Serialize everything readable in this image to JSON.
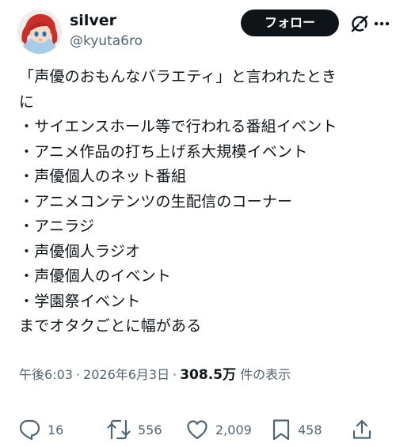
{
  "user": {
    "display_name": "silver",
    "handle": "@kyuta6ro"
  },
  "header": {
    "follow_label": "フォロー"
  },
  "post": {
    "lines": [
      "「声優のおもんなバラエティ」と言われたとき",
      "に",
      "・サイエンスホール等で行われる番組イベント",
      "・アニメ作品の打ち上げ系大規模イベント",
      "・声優個人のネット番組",
      "・アニメコンテンツの生配信のコーナー",
      "・アニラジ",
      "・声優個人ラジオ",
      "・声優個人のイベント",
      "・学園祭イベント",
      "までオタクごとに幅がある"
    ]
  },
  "meta": {
    "time": "午後6:03",
    "separator": "·",
    "date": "2026年6月3日",
    "views": "308.5万",
    "views_label": "件の表示"
  },
  "actions": {
    "reply_count": "16",
    "repost_count": "556",
    "like_count": "2,009",
    "bookmark_count": "458"
  },
  "icons": {
    "grok": "grok-icon",
    "more": "more-icon",
    "reply": "reply-icon",
    "repost": "repost-icon",
    "like": "heart-icon",
    "bookmark": "bookmark-icon",
    "share": "share-icon"
  },
  "colors": {
    "text": "#0f1419",
    "secondary": "#536471",
    "follow_bg": "#0f1419"
  }
}
